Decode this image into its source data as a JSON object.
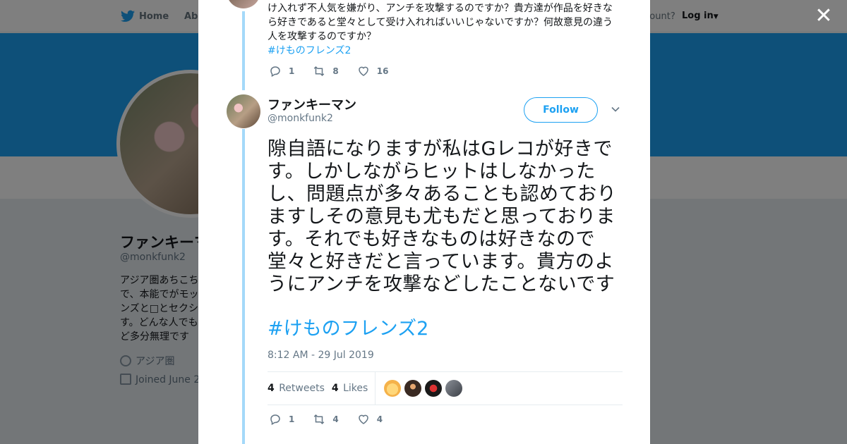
{
  "background": {
    "nav": {
      "home": "Home",
      "about": "Abo",
      "account": "ccount?",
      "login": "Log in"
    },
    "profile": {
      "name": "ファンキーマ",
      "handle": "@monkfunk2",
      "bio": "アジア圏あちこちで、本能でがモッンズと□とセクシす。どんな人でもど多分無理です",
      "location": "アジア圏",
      "joined": "Joined June 20"
    }
  },
  "modal": {
    "previous_tweet": {
      "text": "け入れず不人気を嫌がり、アンチを攻撃するのですか？貴方達が作品を好きなら好きであると堂々として受け入れればいいじゃないですか？何故意見の違う人を攻撃するのですか？",
      "hashtag": "#けものフレンズ2",
      "replies": "1",
      "retweets": "8",
      "likes": "16"
    },
    "tweet": {
      "author_name": "ファンキーマン",
      "author_handle": "@monkfunk2",
      "follow_label": "Follow",
      "text": "隙自語になりますが私はGレコが好きです。しかしながらヒットはしなかったし、問題点が多々あることも認めておりますしその意見も尤もだと思っております。それでも好きなものは好きなので堂々と好きだと言っています。貴方のようにアンチを攻撃などしたことないです",
      "hashtag": "#けものフレンズ2",
      "timestamp": "8:12 AM - 29 Jul 2019",
      "retweets_count": "4",
      "retweets_label": "Retweets",
      "likes_count": "4",
      "likes_label": "Likes",
      "replies": "1",
      "retweets": "4",
      "likes": "4"
    }
  },
  "colors": {
    "accent": "#1da1f2",
    "thread": "#a4d9f9",
    "muted": "#657786"
  }
}
